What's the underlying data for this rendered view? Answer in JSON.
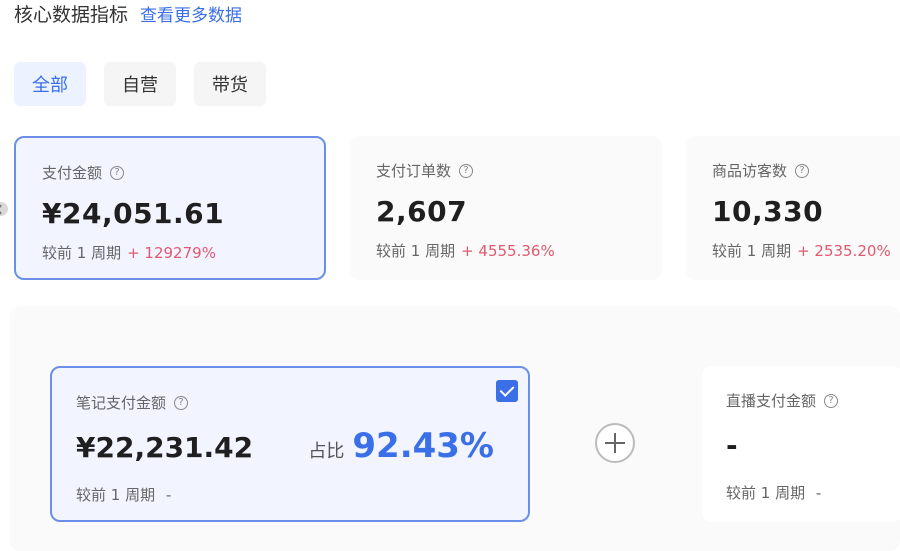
{
  "header": {
    "title": "核心数据指标",
    "more_link": "查看更多数据"
  },
  "tabs": [
    {
      "label": "全部",
      "active": true
    },
    {
      "label": "自营",
      "active": false
    },
    {
      "label": "带货",
      "active": false
    }
  ],
  "metrics": [
    {
      "label": "支付金额",
      "value": "¥24,051.61",
      "compare_label": "较前 1 周期",
      "change": "+ 129279%"
    },
    {
      "label": "支付订单数",
      "value": "2,607",
      "compare_label": "较前 1 周期",
      "change": "+ 4555.36%"
    },
    {
      "label": "商品访客数",
      "value": "10,330",
      "compare_label": "较前 1 周期",
      "change": "+ 2535.20%"
    }
  ],
  "breakdown": {
    "note_card": {
      "label": "笔记支付金额",
      "value": "¥22,231.42",
      "share_label": "占比",
      "share_value": "92.43%",
      "compare_label": "较前 1 周期",
      "change": "-"
    },
    "live_card": {
      "label": "直播支付金额",
      "value": "-",
      "compare_label": "较前 1 周期",
      "change": "-"
    }
  },
  "icons": {
    "help": "question-circle-icon",
    "check": "checkbox-checked-icon",
    "plus": "plus-circle-icon"
  },
  "colors": {
    "accent": "#3a6fe8",
    "positive_change": "#e05a6e"
  }
}
